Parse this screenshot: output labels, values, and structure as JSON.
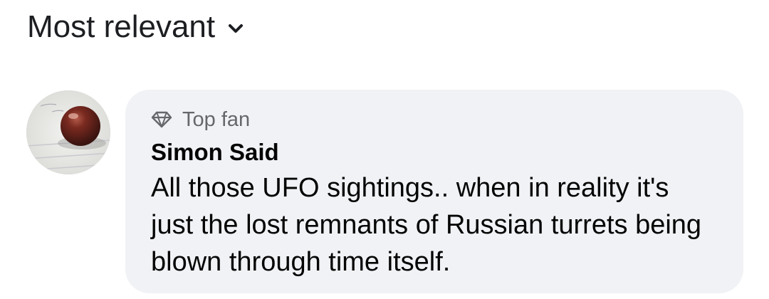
{
  "sort": {
    "label": "Most relevant",
    "icon": "chevron-down-icon"
  },
  "comment": {
    "avatar_icon": "profile-photo",
    "badge": {
      "icon": "diamond-icon",
      "label": "Top fan"
    },
    "author": "Simon Said",
    "text": "All those UFO sightings.. when in reality it's just the lost remnants of Russian turrets being blown through time itself."
  },
  "colors": {
    "bubble_background": "#f0f2f5",
    "secondary_text": "#65676b",
    "primary_text": "#050505"
  }
}
